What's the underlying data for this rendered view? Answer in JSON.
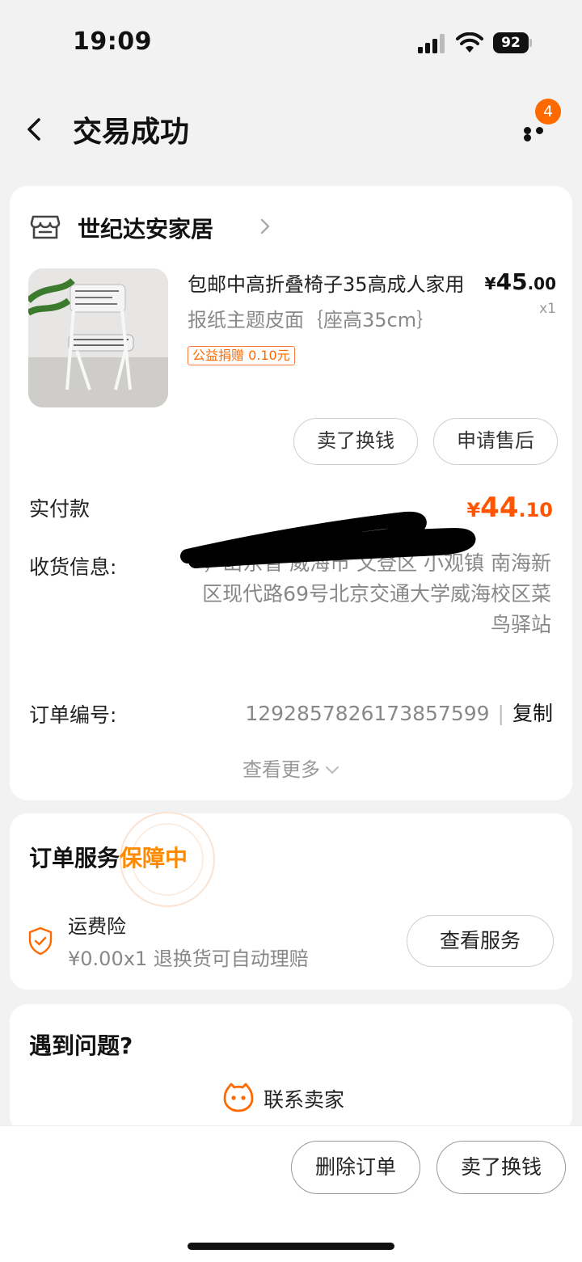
{
  "status_bar": {
    "time": "19:09",
    "battery": "92"
  },
  "nav": {
    "title": "交易成功",
    "badge_count": "4"
  },
  "shop": {
    "name": "世纪达安家居"
  },
  "product": {
    "title": "包邮中高折叠椅子35高成人家用",
    "sku": "报纸主题皮面｛座高35cm｝",
    "charity_tag": "公益捐赠 0.10元",
    "price_currency": "¥",
    "price_int": "45",
    "price_dec": ".00",
    "quantity": "x1"
  },
  "actions": {
    "sell_label": "卖了换钱",
    "after_sale_label": "申请售后"
  },
  "payment": {
    "label": "实付款",
    "currency": "¥",
    "amount_int": "44",
    "amount_dec": ".10"
  },
  "address": {
    "label": "收货信息:",
    "text": "，山东省 威海市 文登区 小观镇 南海新区现代路69号北京交通大学威海校区菜鸟驿站"
  },
  "order": {
    "label": "订单编号:",
    "number": "1292857826173857599",
    "separator": "|",
    "copy_label": "复制"
  },
  "view_more": "查看更多",
  "service": {
    "title": "订单服务",
    "status": "保障中",
    "item_name": "运费险",
    "item_desc": "¥0.00x1  退换货可自动理赔",
    "view_label": "查看服务"
  },
  "problem": {
    "title": "遇到问题?",
    "contact_label": "联系卖家"
  },
  "bottom": {
    "delete_label": "删除订单",
    "sell_label": "卖了换钱"
  },
  "colors": {
    "accent": "#ff5500",
    "badge": "#ff6a00",
    "status": "#ff8a00"
  },
  "icons": [
    "back-icon",
    "more-icon",
    "shop-icon",
    "chevron-right-icon",
    "chevron-down-icon",
    "shield-icon",
    "contact-icon"
  ]
}
